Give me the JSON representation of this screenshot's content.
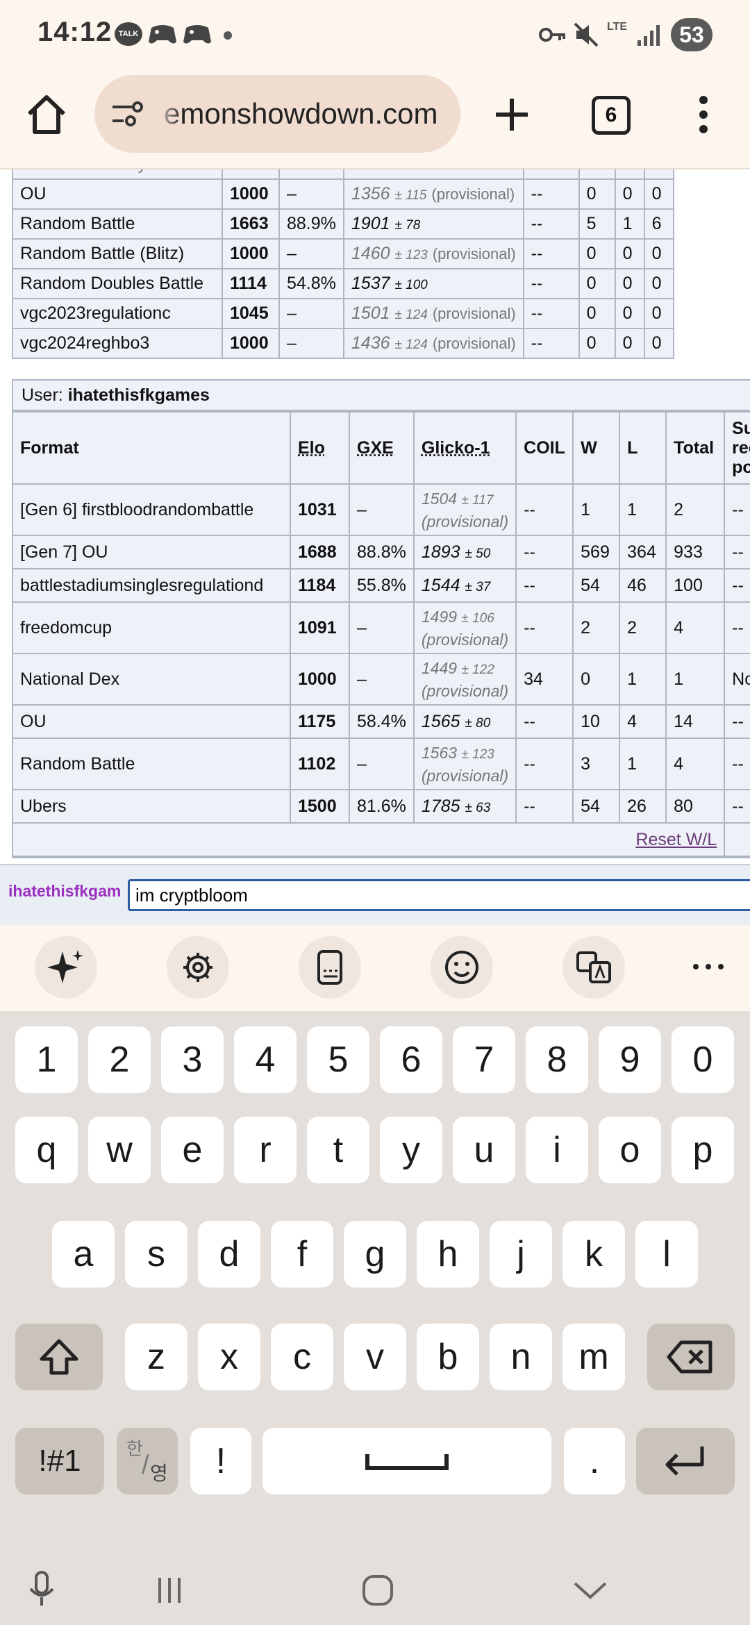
{
  "status_bar": {
    "time": "14:12",
    "talk": "TALK",
    "lte": "LTE",
    "battery": "53"
  },
  "browser": {
    "url": "emonshowdown.com",
    "tab_count": "6"
  },
  "table1": {
    "rows": [
      {
        "format": "OU",
        "elo": "1000",
        "gxe": "–",
        "glicko": "1356",
        "dev": "± 115",
        "prov": "(provisional)",
        "coil": "--",
        "w": "0",
        "l": "0",
        "t": "0"
      },
      {
        "format": "Random Battle",
        "elo": "1663",
        "gxe": "88.9%",
        "glicko": "1901",
        "dev": "± 78",
        "prov": "",
        "coil": "--",
        "w": "5",
        "l": "1",
        "t": "6"
      },
      {
        "format": "Random Battle (Blitz)",
        "elo": "1000",
        "gxe": "–",
        "glicko": "1460",
        "dev": "± 123",
        "prov": "(provisional)",
        "coil": "--",
        "w": "0",
        "l": "0",
        "t": "0"
      },
      {
        "format": "Random Doubles Battle",
        "elo": "1114",
        "gxe": "54.8%",
        "glicko": "1537",
        "dev": "± 100",
        "prov": "",
        "coil": "--",
        "w": "0",
        "l": "0",
        "t": "0"
      },
      {
        "format": "vgc2023regulationc",
        "elo": "1045",
        "gxe": "–",
        "glicko": "1501",
        "dev": "± 124",
        "prov": "(provisional)",
        "coil": "--",
        "w": "0",
        "l": "0",
        "t": "0"
      },
      {
        "format": "vgc2024reghbo3",
        "elo": "1000",
        "gxe": "–",
        "glicko": "1436",
        "dev": "± 124",
        "prov": "(provisional)",
        "coil": "--",
        "w": "0",
        "l": "0",
        "t": "0"
      }
    ]
  },
  "table2": {
    "user_label": "User:",
    "username": "ihatethisfkgames",
    "headers": {
      "format": "Format",
      "elo": "Elo",
      "gxe": "GXE",
      "glicko": "Glicko-1",
      "coil": "COIL",
      "w": "W",
      "l": "L",
      "total": "Total",
      "suspect": "Su\nrec\npo"
    },
    "rows": [
      {
        "format": "[Gen 6] firstbloodrandombattle",
        "elo": "1031",
        "gxe": "–",
        "glicko": "1504",
        "dev": "± 117",
        "prov": "(provisional)",
        "coil": "--",
        "w": "1",
        "l": "1",
        "t": "2",
        "s": "--"
      },
      {
        "format": "[Gen 7] OU",
        "elo": "1688",
        "gxe": "88.8%",
        "glicko": "1893",
        "dev": "± 50",
        "prov": "",
        "coil": "--",
        "w": "569",
        "l": "364",
        "t": "933",
        "s": "--"
      },
      {
        "format": "battlestadiumsinglesregulationd",
        "elo": "1184",
        "gxe": "55.8%",
        "glicko": "1544",
        "dev": "± 37",
        "prov": "",
        "coil": "--",
        "w": "54",
        "l": "46",
        "t": "100",
        "s": "--"
      },
      {
        "format": "freedomcup",
        "elo": "1091",
        "gxe": "–",
        "glicko": "1499",
        "dev": "± 106",
        "prov": "(provisional)",
        "coil": "--",
        "w": "2",
        "l": "2",
        "t": "4",
        "s": "--"
      },
      {
        "format": "National Dex",
        "elo": "1000",
        "gxe": "–",
        "glicko": "1449",
        "dev": "± 122",
        "prov": "(provisional)",
        "coil": "34",
        "w": "0",
        "l": "1",
        "t": "1",
        "s": "No"
      },
      {
        "format": "OU",
        "elo": "1175",
        "gxe": "58.4%",
        "glicko": "1565",
        "dev": "± 80",
        "prov": "",
        "coil": "--",
        "w": "10",
        "l": "4",
        "t": "14",
        "s": "--"
      },
      {
        "format": "Random Battle",
        "elo": "1102",
        "gxe": "–",
        "glicko": "1563",
        "dev": "± 123",
        "prov": "(provisional)",
        "coil": "--",
        "w": "3",
        "l": "1",
        "t": "4",
        "s": "--"
      },
      {
        "format": "Ubers",
        "elo": "1500",
        "gxe": "81.6%",
        "glicko": "1785",
        "dev": "± 63",
        "prov": "",
        "coil": "--",
        "w": "54",
        "l": "26",
        "t": "80",
        "s": "--"
      }
    ],
    "reset": "Reset W/L"
  },
  "chat": {
    "name": "ihatethisfkgam",
    "input": "im cryptbloom"
  },
  "keyboard": {
    "row_numbers": [
      "1",
      "2",
      "3",
      "4",
      "5",
      "6",
      "7",
      "8",
      "9",
      "0"
    ],
    "row1": [
      "q",
      "w",
      "e",
      "r",
      "t",
      "y",
      "u",
      "i",
      "o",
      "p"
    ],
    "row2": [
      "a",
      "s",
      "d",
      "f",
      "g",
      "h",
      "j",
      "k",
      "l"
    ],
    "row3": [
      "z",
      "x",
      "c",
      "v",
      "b",
      "n",
      "m"
    ],
    "sym": "!#1",
    "lang_top": "한",
    "lang_bottom": "영",
    "excl": "!",
    "period": "."
  }
}
